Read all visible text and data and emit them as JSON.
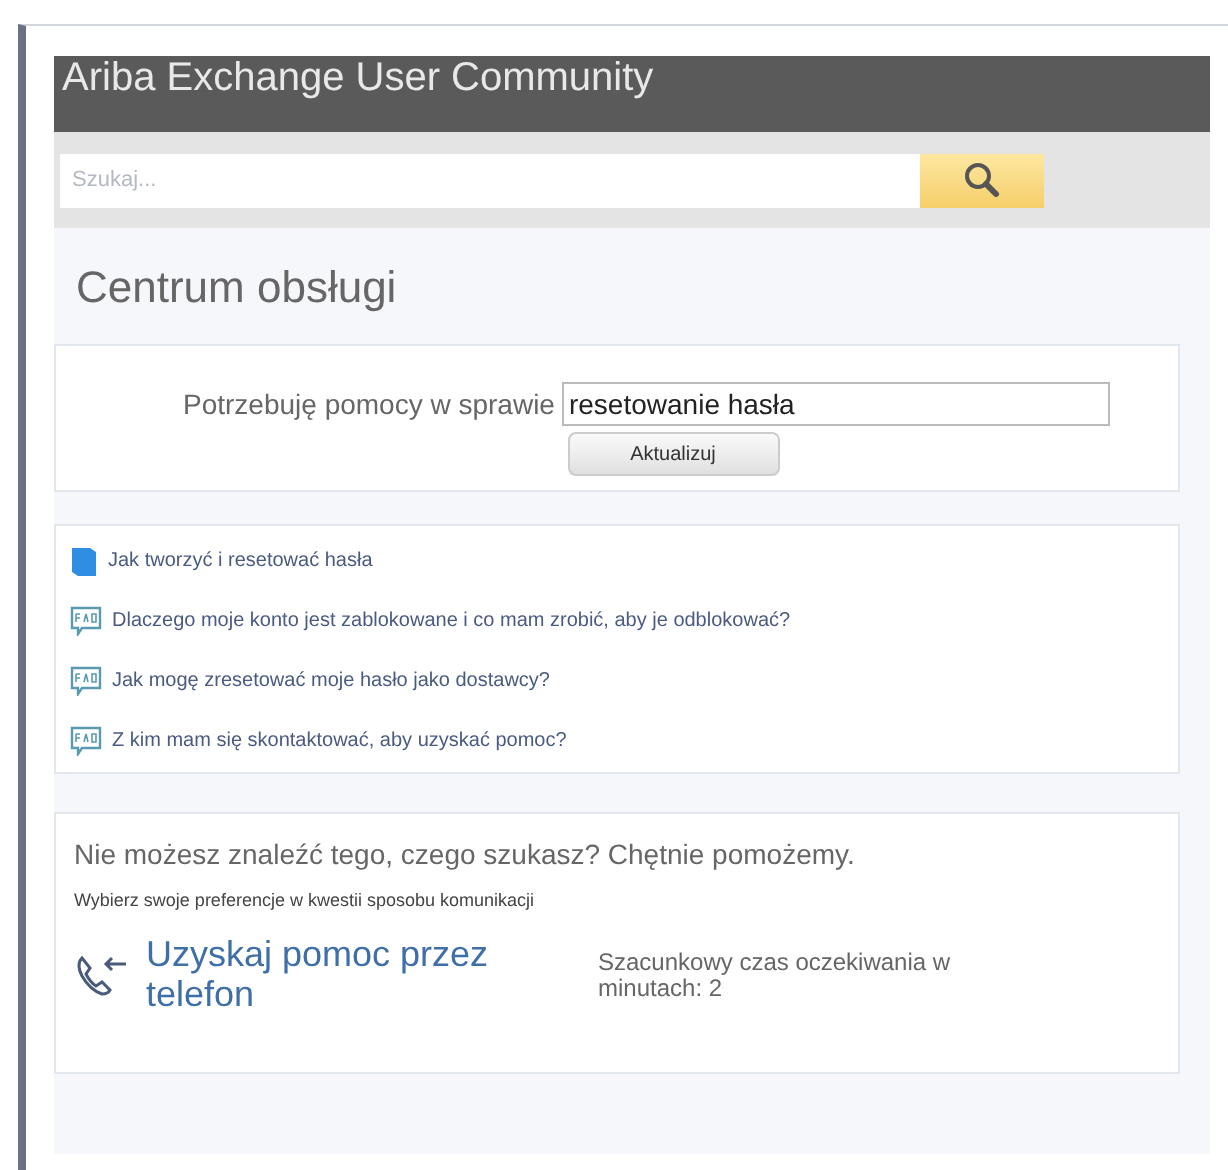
{
  "header": {
    "title": "Ariba Exchange User Community"
  },
  "search": {
    "placeholder": "Szukaj..."
  },
  "page_title": "Centrum obsługi",
  "help_form": {
    "label": "Potrzebuję pomocy w sprawie",
    "value": "resetowanie hasła",
    "button": "Aktualizuj"
  },
  "results": [
    {
      "kind": "book",
      "text": "Jak tworzyć i resetować hasła"
    },
    {
      "kind": "faq",
      "text": "Dlaczego moje konto jest zablokowane i co mam zrobić, aby je odblokować?"
    },
    {
      "kind": "faq",
      "text": "Jak mogę zresetować moje hasło jako dostawcy?"
    },
    {
      "kind": "faq",
      "text": "Z kim mam się skontaktować, aby uzyskać pomoc?"
    }
  ],
  "contact": {
    "heading": "Nie możesz znaleźć tego, czego szukasz? Chętnie pomożemy.",
    "subheading": "Wybierz swoje preferencje w kwestii sposobu komunikacji",
    "phone_link": "Uzyskaj pomoc przez telefon",
    "wait_time": "Szacunkowy czas oczekiwania w minutach: 2"
  }
}
